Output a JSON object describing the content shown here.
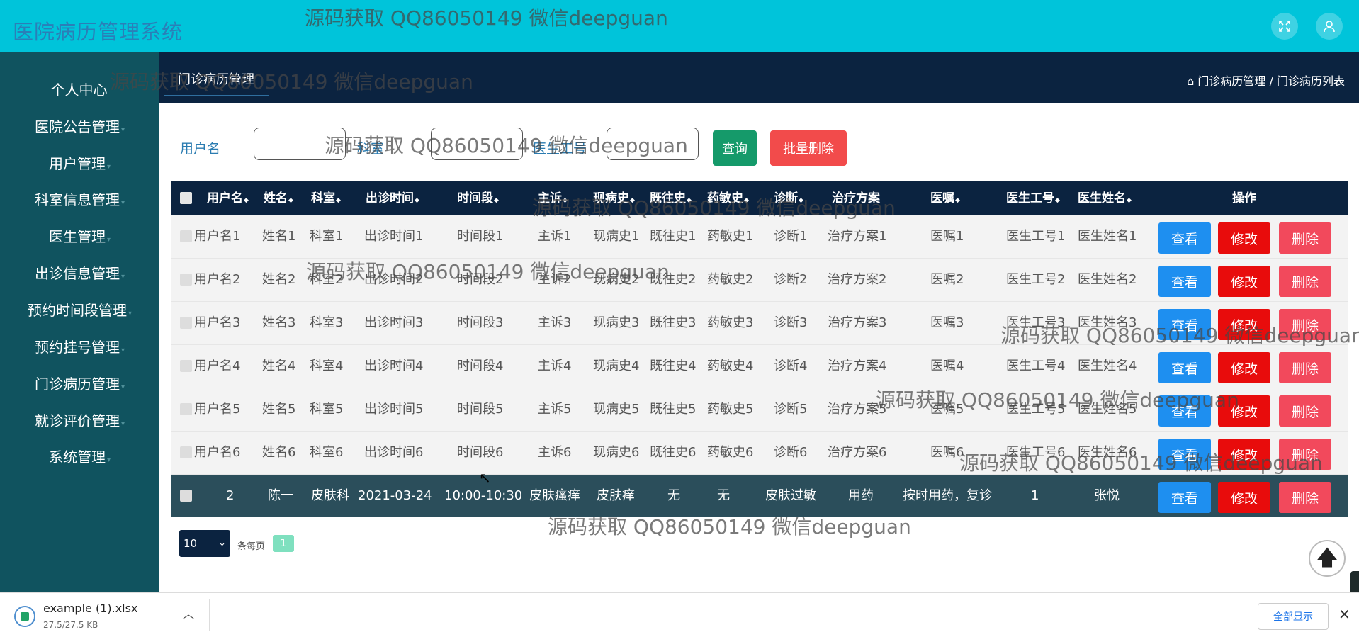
{
  "app": {
    "title": "医院病历管理系统"
  },
  "topbar": {
    "fullscreen_icon": "fullscreen-icon",
    "user_icon": "user-icon"
  },
  "sidebar": {
    "items": [
      {
        "label": "个人中心",
        "caret": ""
      },
      {
        "label": "医院公告管理",
        "caret": "▾"
      },
      {
        "label": "用户管理",
        "caret": "▾"
      },
      {
        "label": "科室信息管理",
        "caret": "▾"
      },
      {
        "label": "医生管理",
        "caret": "▾"
      },
      {
        "label": "出诊信息管理",
        "caret": "▾"
      },
      {
        "label": "预约时间段管理",
        "caret": "▾"
      },
      {
        "label": "预约挂号管理",
        "caret": "▾"
      },
      {
        "label": "门诊病历管理",
        "caret": "▾"
      },
      {
        "label": "就诊评价管理",
        "caret": "▾"
      },
      {
        "label": "系统管理",
        "caret": "▾"
      }
    ]
  },
  "header": {
    "tab": "门诊病历管理",
    "breadcrumb": "门诊病历管理 / 门诊病历列表",
    "home_icon": "⌂"
  },
  "search": {
    "fields": [
      {
        "label": "用户名",
        "value": ""
      },
      {
        "label": "科室",
        "value": ""
      },
      {
        "label": "医生工号",
        "value": ""
      }
    ],
    "query_button": "查询",
    "batch_delete_button": "批量删除"
  },
  "table": {
    "sort_arrow": "◆",
    "columns": [
      "用户名",
      "姓名",
      "科室",
      "出诊时间",
      "时间段",
      "主诉",
      "现病史",
      "既往史",
      "药敏史",
      "诊断",
      "治疗方案",
      "医嘱",
      "医生工号",
      "医生姓名",
      "操作"
    ],
    "rows": [
      [
        "用户名1",
        "姓名1",
        "科室1",
        "出诊时间1",
        "时间段1",
        "主诉1",
        "现病史1",
        "既往史1",
        "药敏史1",
        "诊断1",
        "治疗方案1",
        "医嘱1",
        "医生工号1",
        "医生姓名1"
      ],
      [
        "用户名2",
        "姓名2",
        "科室2",
        "出诊时间2",
        "时间段2",
        "主诉2",
        "现病史2",
        "既往史2",
        "药敏史2",
        "诊断2",
        "治疗方案2",
        "医嘱2",
        "医生工号2",
        "医生姓名2"
      ],
      [
        "用户名3",
        "姓名3",
        "科室3",
        "出诊时间3",
        "时间段3",
        "主诉3",
        "现病史3",
        "既往史3",
        "药敏史3",
        "诊断3",
        "治疗方案3",
        "医嘱3",
        "医生工号3",
        "医生姓名3"
      ],
      [
        "用户名4",
        "姓名4",
        "科室4",
        "出诊时间4",
        "时间段4",
        "主诉4",
        "现病史4",
        "既往史4",
        "药敏史4",
        "诊断4",
        "治疗方案4",
        "医嘱4",
        "医生工号4",
        "医生姓名4"
      ],
      [
        "用户名5",
        "姓名5",
        "科室5",
        "出诊时间5",
        "时间段5",
        "主诉5",
        "现病史5",
        "既往史5",
        "药敏史5",
        "诊断5",
        "治疗方案5",
        "医嘱5",
        "医生工号5",
        "医生姓名5"
      ],
      [
        "用户名6",
        "姓名6",
        "科室6",
        "出诊时间6",
        "时间段6",
        "主诉6",
        "现病史6",
        "既往史6",
        "药敏史6",
        "诊断6",
        "治疗方案6",
        "医嘱6",
        "医生工号6",
        "医生姓名6"
      ],
      [
        "2",
        "陈一",
        "皮肤科",
        "2021-03-24",
        "10:00-10:30",
        "皮肤瘙痒",
        "皮肤痒",
        "无",
        "无",
        "皮肤过敏",
        "用药",
        "按时用药，复诊",
        "1",
        "张悦"
      ]
    ],
    "highlight_row": 6,
    "actions": {
      "view": "查看",
      "edit": "修改",
      "delete": "删除"
    }
  },
  "pagination": {
    "page_size": "10",
    "per_page_label": "条每页",
    "current_page": "1"
  },
  "scroll_top_icon": "arrow-up-icon",
  "download_bar": {
    "file_name": "example (1).xlsx",
    "file_size": "27.5/27.5 KB",
    "show_all": "全部显示",
    "close": "✕"
  },
  "watermarks": [
    "源码获取 QQ86050149 微信deepguan",
    "源码获取 QQ86050149 微信deepguan",
    "源码获取 QQ86050149 微信deepguan",
    "源码获取 QQ86050149 微信deepguan",
    "源码获取 QQ86050149 微信deepguan",
    "源码获取 QQ86050149 微信deepguan",
    "源码获取 QQ86050149 微信deepguan",
    "源码获取 QQ86050149 微信deepguan",
    "源码获取 QQ86050149 微信deepguan"
  ],
  "colors": {
    "topbar": "#00c4da",
    "sidebar": "#10535f",
    "header": "#0b2340",
    "view_button": "#1e8ff0",
    "edit_button": "#e80c0c",
    "delete_button": "#f2495c"
  }
}
